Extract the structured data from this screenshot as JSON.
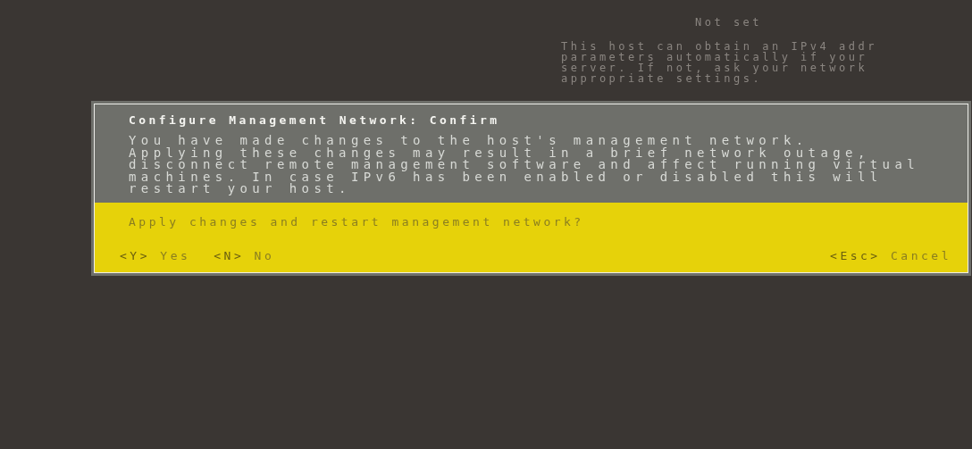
{
  "background_screen": {
    "status": "Not set",
    "lines": [
      "This host can obtain an IPv4 addr",
      "parameters automatically if your",
      "server. If not, ask your network",
      "appropriate settings."
    ]
  },
  "dialog": {
    "title": "Configure Management Network: Confirm",
    "message": "You have made changes to the host's management network.\nApplying these changes may result in a brief network outage,\ndisconnect remote management software and affect running virtual\nmachines. In case IPv6 has been enabled or disabled this will\nrestart your host.",
    "question": "Apply changes and restart management network?",
    "left_actions": [
      {
        "key": "<Y>",
        "label": "Yes"
      },
      {
        "key": "<N>",
        "label": "No"
      }
    ],
    "right_actions": [
      {
        "key": "<Esc>",
        "label": "Cancel"
      }
    ]
  }
}
